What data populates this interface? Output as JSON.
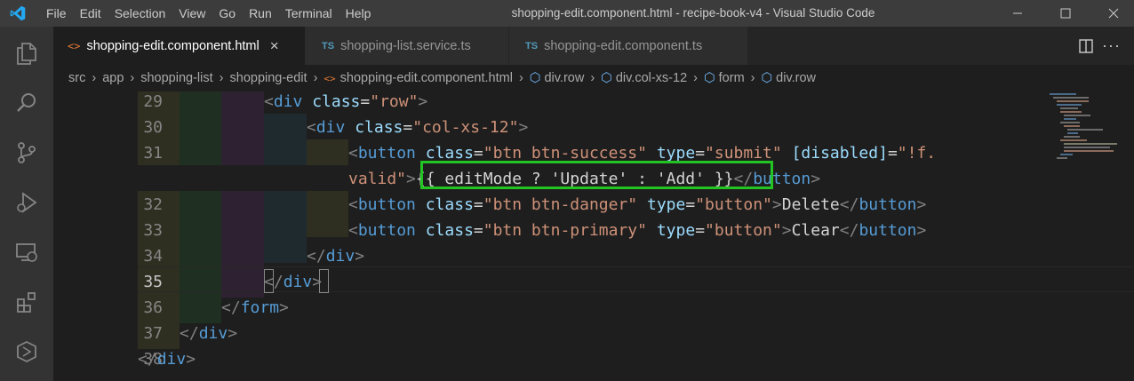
{
  "window": {
    "title": "shopping-edit.component.html - recipe-book-v4 - Visual Studio Code",
    "menu": [
      "File",
      "Edit",
      "Selection",
      "View",
      "Go",
      "Run",
      "Terminal",
      "Help"
    ]
  },
  "tabs": [
    {
      "label": "shopping-edit.component.html",
      "type": "html",
      "active": true
    },
    {
      "label": "shopping-list.service.ts",
      "type": "ts",
      "active": false
    },
    {
      "label": "shopping-edit.component.ts",
      "type": "ts",
      "active": false
    }
  ],
  "tab_icons": {
    "html": "<>",
    "ts": "TS",
    "close": "×"
  },
  "breadcrumb": [
    "src",
    "app",
    "shopping-list",
    "shopping-edit",
    "shopping-edit.component.html",
    "div.row",
    "div.col-xs-12",
    "form",
    "div.row"
  ],
  "gutter": [
    "29",
    "30",
    "31",
    "32",
    "33",
    "34",
    "35",
    "36",
    "37",
    "38"
  ],
  "current_line": "35",
  "code": {
    "l29": {
      "tag": "div",
      "attr": "class",
      "val": "\"row\""
    },
    "l30": {
      "tag": "div",
      "attr": "class",
      "val": "\"col-xs-12\""
    },
    "l31": {
      "tag": "button",
      "attr1": "class",
      "val1": "\"btn btn-success\"",
      "attr2": "type",
      "val2": "\"submit\"",
      "attr3": "[disabled]",
      "val3": "\"!f."
    },
    "l31b": {
      "val": "valid\"",
      "expr": "{{ editMode ? 'Update' : 'Add' }}",
      "close": "button"
    },
    "l32": {
      "tag": "button",
      "attr1": "class",
      "val1": "\"btn btn-danger\"",
      "attr2": "type",
      "val2": "\"button\"",
      "text": "Delete"
    },
    "l33": {
      "tag": "button",
      "attr1": "class",
      "val1": "\"btn btn-primary\"",
      "attr2": "type",
      "val2": "\"button\"",
      "text": "Clear"
    },
    "l34": {
      "close": "div"
    },
    "l35": {
      "close": "div"
    },
    "l36": {
      "close": "form"
    },
    "l37": {
      "close": "div"
    },
    "l38": {
      "close": "div"
    }
  },
  "punct": {
    "lt": "<",
    "gt": ">",
    "ltslash": "</",
    "eq": "="
  },
  "colors": {
    "highlight_box": "#22c322",
    "tag": "#569cd6",
    "attribute": "#9cdcfe",
    "string": "#ce9178",
    "vscode_blue": "#007acc"
  }
}
